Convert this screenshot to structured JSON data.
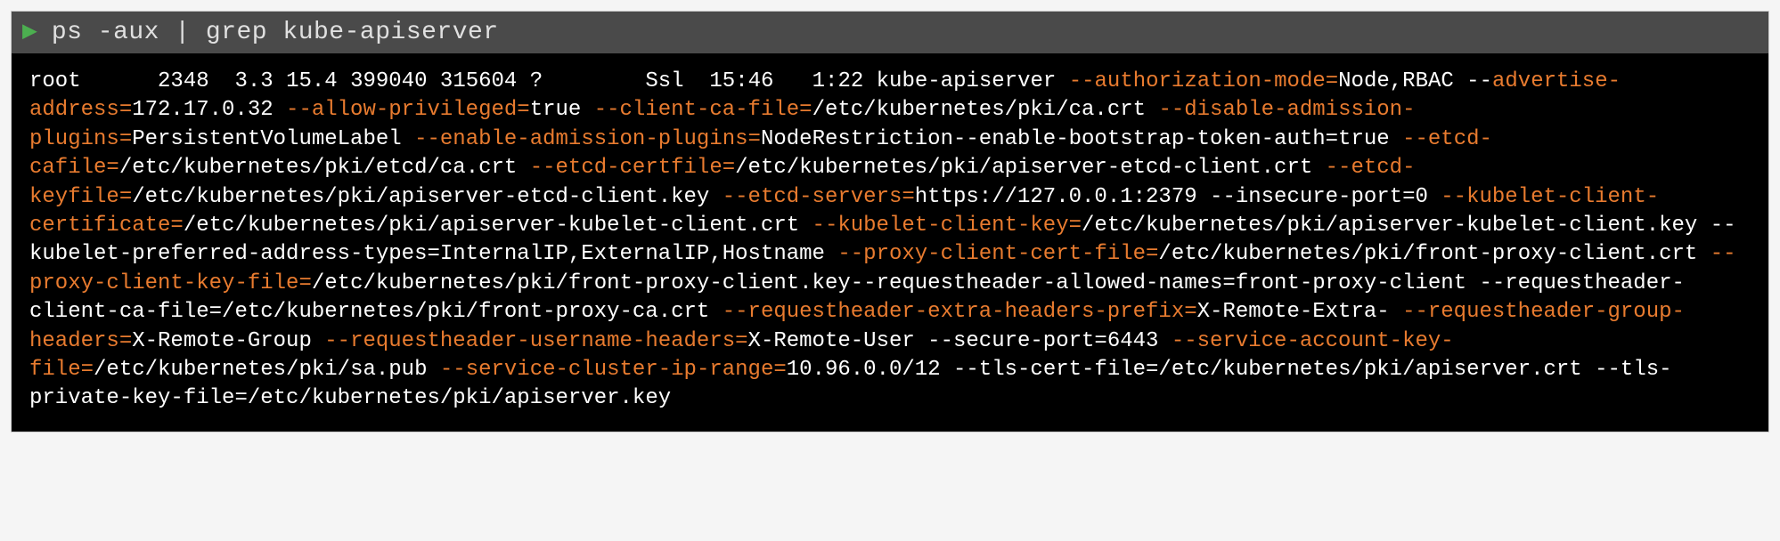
{
  "header": {
    "prompt_symbol": "▶",
    "command": "ps -aux | grep kube-apiserver"
  },
  "process": {
    "user": "root",
    "pid": "2348",
    "cpu": "3.3",
    "mem": "15.4",
    "vsz": "399040",
    "rss": "315604",
    "tty": "?",
    "stat": "Ssl",
    "start": "15:46",
    "time": "1:22",
    "cmd": "kube-apiserver"
  },
  "flags": {
    "authorization_mode": {
      "flag": "--authorization-mode=",
      "value": "Node,RBAC --"
    },
    "advertise_address": {
      "flag": "advertise-address=",
      "value": "172.17.0.32 "
    },
    "allow_privileged": {
      "flag": "--allow-privileged=",
      "value": "true "
    },
    "client_ca_file": {
      "flag": "--client-ca-file=",
      "value": "/etc/kubernetes/pki/ca.crt "
    },
    "disable_admission_plugins": {
      "flag": "--disable-admission-plugins=",
      "value": "PersistentVolumeLabel "
    },
    "enable_admission_plugins": {
      "flag": "--enable-admission-plugins=",
      "value": "NodeRestriction--enable-bootstrap-token-auth=true "
    },
    "etcd_cafile": {
      "flag": "--etcd-cafile=",
      "value": "/etc/kubernetes/pki/etcd/ca.crt "
    },
    "etcd_certfile": {
      "flag": "--etcd-certfile=",
      "value": "/etc/kubernetes/pki/apiserver-etcd-client.crt "
    },
    "etcd_keyfile": {
      "flag": "--etcd-keyfile=",
      "value": "/etc/kubernetes/pki/apiserver-etcd-client.key "
    },
    "etcd_servers": {
      "flag": "--etcd-servers=",
      "value": "https://127.0.0.1:2379 --insecure-port=0 "
    },
    "kubelet_client_certificate": {
      "flag": "--kubelet-client-certificate=",
      "value": "/etc/kubernetes/pki/apiserver-kubelet-client.crt "
    },
    "kubelet_client_key": {
      "flag": "--kubelet-client-key=",
      "value": "/etc/kubernetes/pki/apiserver-kubelet-client.key --kubelet-preferred-address-types=InternalIP,ExternalIP,Hostname "
    },
    "proxy_client_cert_file": {
      "flag": "--proxy-client-cert-file=",
      "value": "/etc/kubernetes/pki/front-proxy-client.crt "
    },
    "proxy_client_key_file": {
      "flag": "--proxy-client-key-file=",
      "value": "/etc/kubernetes/pki/front-proxy-client.key--requestheader-allowed-names=front-proxy-client --requestheader-client-ca-file=/etc/kubernetes/pki/front-proxy-ca.crt "
    },
    "requestheader_extra_headers_prefix": {
      "flag": "--requestheader-extra-headers-prefix=",
      "value": "X-Remote-Extra- "
    },
    "requestheader_group_headers": {
      "flag": "--requestheader-group-headers=",
      "value": "X-Remote-Group "
    },
    "requestheader_username_headers": {
      "flag": "--requestheader-username-headers=",
      "value": "X-Remote-User --secure-port=6443 "
    },
    "service_account_key_file": {
      "flag": "--service-account-key-file=",
      "value": "/etc/kubernetes/pki/sa.pub "
    },
    "service_cluster_ip_range": {
      "flag": "--service-cluster-ip-range=",
      "value": "10.96.0.0/12 --tls-cert-file=/etc/kubernetes/pki/apiserver.crt --tls-private-key-file=/etc/kubernetes/pki/apiserver.key"
    }
  }
}
